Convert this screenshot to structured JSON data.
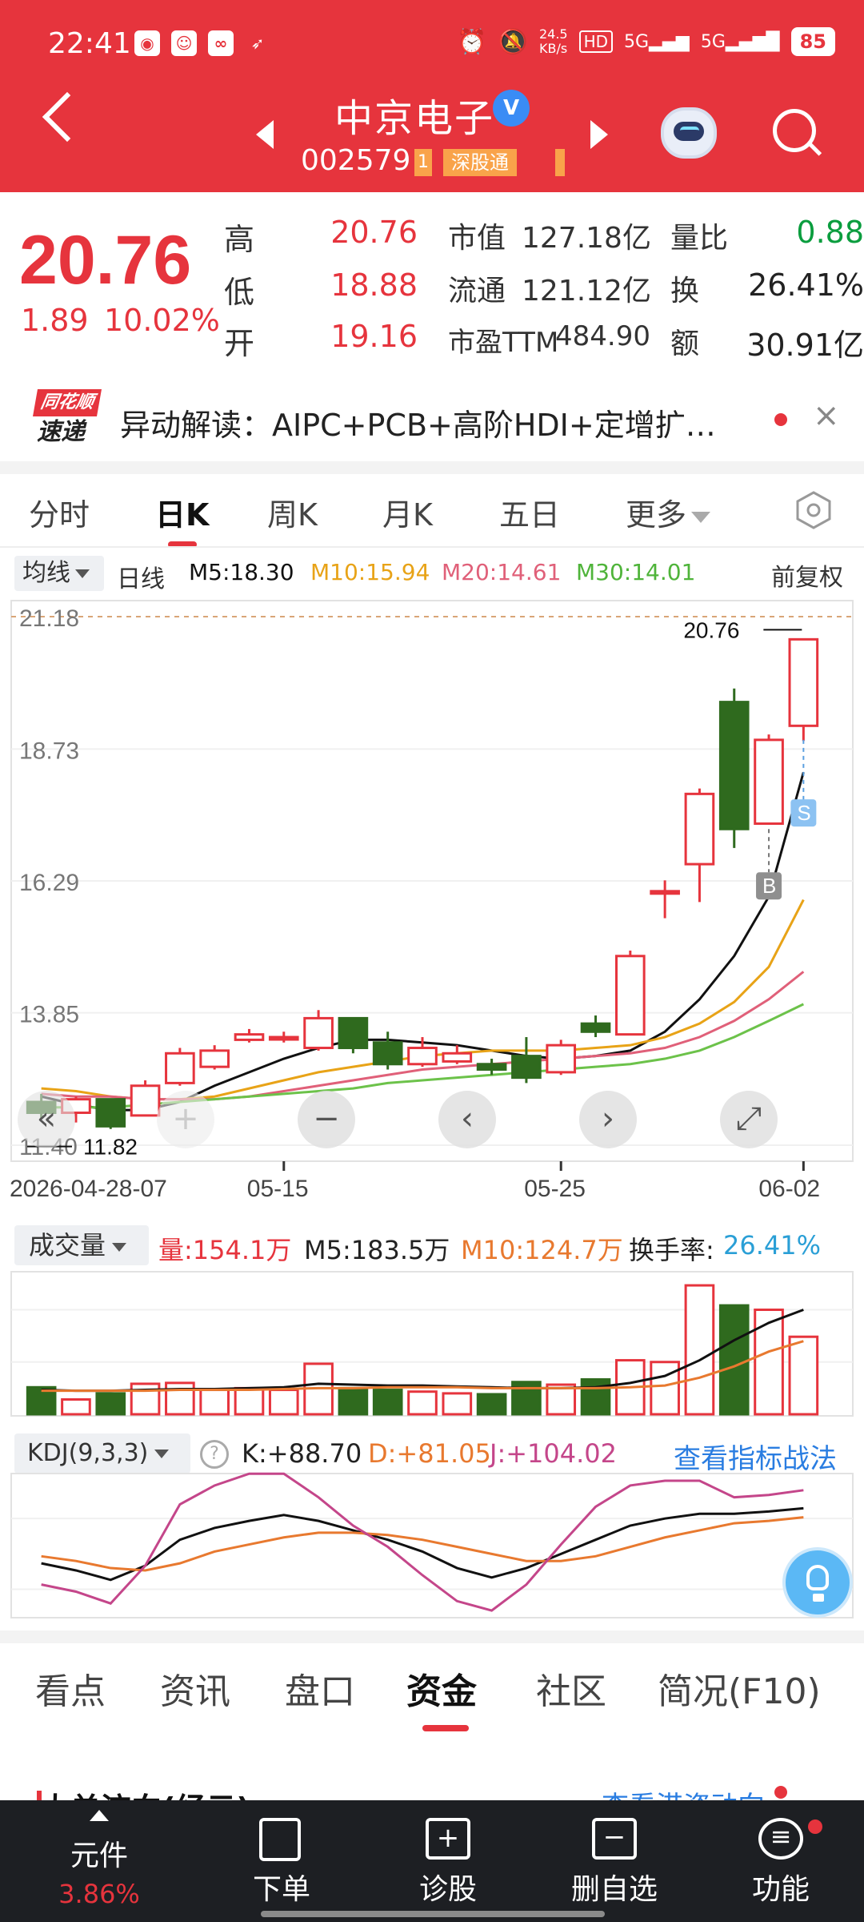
{
  "status_bar": {
    "time": "22:41",
    "net_speed_top": "24.5",
    "net_speed_bottom": "KB/s",
    "hd_label": "HD",
    "sig1": "5G",
    "sig2": "5G",
    "battery": "85"
  },
  "header": {
    "stock_name": "中京电子",
    "verified_glyph": "V",
    "stock_code": "002579",
    "tag_small": "1",
    "tag_connect": "深股通"
  },
  "quote": {
    "price": "20.76",
    "change": "1.89",
    "change_pct": "10.02%",
    "high_label": "高",
    "high": "20.76",
    "low_label": "低",
    "low": "18.88",
    "open_label": "开",
    "open": "19.16",
    "mcap_label": "市值",
    "mcap": "127.18亿",
    "float_label": "流通",
    "float": "121.12亿",
    "pe_label": "市盈TTM",
    "pe": "484.90",
    "vr_label": "量比",
    "vr": "0.88",
    "turnover_label": "换",
    "turnover": "26.41%",
    "amount_label": "额",
    "amount": "30.91亿"
  },
  "news": {
    "logo_top": "同花顺",
    "logo_bottom": "速递",
    "text": "异动解读：AIPC+PCB+高阶HDI+定增扩…",
    "close": "×"
  },
  "tabs": [
    "分时",
    "日K",
    "周K",
    "月K",
    "五日",
    "更多"
  ],
  "ma_row": {
    "selector": "均线",
    "period": "日线",
    "m5": "M5:18.30",
    "m10": "M10:15.94",
    "m20": "M20:14.61",
    "m30": "M30:14.01",
    "adjust": "前复权"
  },
  "kline_chart": {
    "y_labels": [
      "21.18",
      "18.73",
      "16.29",
      "13.85",
      "11.40"
    ],
    "x_labels": [
      "2026-04-28-07",
      "05-15",
      "05-25",
      "06-02"
    ],
    "max_label": "20.76",
    "min_label": "11.82",
    "marker_s": "S",
    "marker_b": "B"
  },
  "chart_controls": [
    "«",
    "+",
    "−",
    "‹",
    "›",
    "⤢"
  ],
  "volume_row": {
    "selector": "成交量",
    "vol": "量:154.1万",
    "m5": "M5:183.5万",
    "m10": "M10:124.7万",
    "turnover_label": "换手率:",
    "turnover_value": "26.41%"
  },
  "kdj_row": {
    "selector": "KDJ(9,3,3)",
    "help": "?",
    "k": "K:+88.70",
    "d": "D:+81.05",
    "j": "J:+104.02",
    "link": "查看指标战法"
  },
  "bottom_tabs": [
    "看点",
    "资讯",
    "盘口",
    "资金",
    "社区",
    "简况(F10)"
  ],
  "peek": {
    "title": "大单流向(经云)",
    "link": "查看港资动向"
  },
  "bottom_nav": {
    "items": [
      "元件",
      "下单",
      "诊股",
      "删自选",
      "功能"
    ],
    "sub": "3.86%"
  },
  "colors": {
    "up": "#e6343d",
    "down": "#2f6a1e",
    "ma5": "#111111",
    "ma10": "#e8a317",
    "ma20": "#e06079",
    "ma30": "#6cc24a",
    "accent_blue": "#2a7de1"
  },
  "chart_data": [
    {
      "type": "candlestick",
      "title": "",
      "ylim": [
        11.4,
        21.18
      ],
      "y_ticks": [
        21.18,
        18.73,
        16.29,
        13.85,
        11.4
      ],
      "x_ticks": [
        "2026-04-28-07",
        "05-15",
        "05-25",
        "06-02"
      ],
      "candles": [
        {
          "o": 12.2,
          "h": 12.35,
          "l": 11.9,
          "c": 12.0
        },
        {
          "o": 12.0,
          "h": 12.3,
          "l": 11.82,
          "c": 12.25
        },
        {
          "o": 12.25,
          "h": 12.15,
          "l": 11.7,
          "c": 11.75
        },
        {
          "o": 11.95,
          "h": 12.6,
          "l": 11.95,
          "c": 12.5
        },
        {
          "o": 12.55,
          "h": 13.2,
          "l": 12.5,
          "c": 13.1
        },
        {
          "o": 12.85,
          "h": 13.25,
          "l": 12.8,
          "c": 13.15
        },
        {
          "o": 13.35,
          "h": 13.55,
          "l": 13.3,
          "c": 13.45
        },
        {
          "o": 13.4,
          "h": 13.5,
          "l": 13.3,
          "c": 13.4
        },
        {
          "o": 13.2,
          "h": 13.9,
          "l": 13.15,
          "c": 13.75
        },
        {
          "o": 13.75,
          "h": 13.75,
          "l": 13.1,
          "c": 13.2
        },
        {
          "o": 13.3,
          "h": 13.5,
          "l": 12.8,
          "c": 12.9
        },
        {
          "o": 12.9,
          "h": 13.4,
          "l": 12.85,
          "c": 13.2
        },
        {
          "o": 12.95,
          "h": 13.25,
          "l": 12.9,
          "c": 13.1
        },
        {
          "o": 12.9,
          "h": 13.0,
          "l": 12.7,
          "c": 12.8
        },
        {
          "o": 13.05,
          "h": 13.4,
          "l": 12.55,
          "c": 12.65
        },
        {
          "o": 12.75,
          "h": 13.35,
          "l": 12.7,
          "c": 13.25
        },
        {
          "o": 13.65,
          "h": 13.8,
          "l": 13.4,
          "c": 13.5
        },
        {
          "o": 13.45,
          "h": 15.0,
          "l": 13.45,
          "c": 14.9
        },
        {
          "o": 16.1,
          "h": 16.3,
          "l": 15.6,
          "c": 16.1
        },
        {
          "o": 16.6,
          "h": 18.0,
          "l": 15.9,
          "c": 17.9
        },
        {
          "o": 19.6,
          "h": 19.85,
          "l": 16.9,
          "c": 17.25
        },
        {
          "o": 17.35,
          "h": 19.0,
          "l": 17.35,
          "c": 18.9
        },
        {
          "o": 19.16,
          "h": 20.76,
          "l": 18.88,
          "c": 20.76
        }
      ],
      "series": [
        {
          "name": "M5",
          "values": [
            12.3,
            12.15,
            12.05,
            12.05,
            12.2,
            12.5,
            12.75,
            13.0,
            13.2,
            13.35,
            13.35,
            13.3,
            13.25,
            13.15,
            13.05,
            13.0,
            13.05,
            13.15,
            13.5,
            14.1,
            14.9,
            16.0,
            18.3
          ]
        },
        {
          "name": "M10",
          "values": [
            12.45,
            12.4,
            12.3,
            12.25,
            12.25,
            12.3,
            12.45,
            12.6,
            12.75,
            12.85,
            12.95,
            13.05,
            13.1,
            13.15,
            13.15,
            13.15,
            13.2,
            13.25,
            13.4,
            13.65,
            14.05,
            14.7,
            15.94
          ]
        },
        {
          "name": "M20",
          "values": [
            12.35,
            12.3,
            12.3,
            12.25,
            12.25,
            12.25,
            12.3,
            12.4,
            12.5,
            12.6,
            12.7,
            12.8,
            12.85,
            12.9,
            12.95,
            13.0,
            13.05,
            13.1,
            13.2,
            13.4,
            13.7,
            14.1,
            14.61
          ]
        },
        {
          "name": "M30",
          "values": [
            12.1,
            12.1,
            12.1,
            12.15,
            12.2,
            12.25,
            12.3,
            12.35,
            12.4,
            12.45,
            12.55,
            12.6,
            12.65,
            12.7,
            12.75,
            12.8,
            12.85,
            12.9,
            13.0,
            13.15,
            13.4,
            13.7,
            14.01
          ]
        }
      ],
      "annotations": {
        "max": 20.76,
        "min": 11.82
      }
    },
    {
      "type": "bar",
      "title": "",
      "unit": "万",
      "values": [
        31,
        17,
        24,
        35,
        36,
        28,
        30,
        28,
        58,
        30,
        28,
        26,
        24,
        23,
        37,
        34,
        40,
        62,
        60,
        148,
        125,
        120,
        89
      ],
      "up": [
        false,
        true,
        false,
        true,
        true,
        true,
        true,
        true,
        true,
        false,
        false,
        true,
        true,
        false,
        false,
        true,
        false,
        true,
        true,
        true,
        false,
        true,
        true
      ],
      "series": [
        {
          "name": "M5",
          "values": [
            28,
            27,
            27,
            28,
            29,
            29,
            30,
            31,
            35,
            34,
            33,
            33,
            32,
            31,
            30,
            30,
            31,
            36,
            44,
            62,
            85,
            105,
            120
          ]
        },
        {
          "name": "M10",
          "values": [
            27,
            27,
            27,
            27,
            28,
            28,
            28,
            29,
            30,
            30,
            31,
            31,
            31,
            30,
            30,
            30,
            30,
            31,
            33,
            42,
            55,
            72,
            84
          ]
        }
      ]
    },
    {
      "type": "line",
      "title": "",
      "ylim": [
        0,
        110
      ],
      "series": [
        {
          "name": "K",
          "values": [
            42,
            36,
            28,
            40,
            62,
            72,
            78,
            83,
            78,
            70,
            62,
            52,
            38,
            30,
            38,
            50,
            62,
            74,
            80,
            84,
            84,
            86,
            88.7
          ]
        },
        {
          "name": "D",
          "values": [
            48,
            44,
            38,
            36,
            42,
            52,
            58,
            64,
            68,
            68,
            66,
            62,
            56,
            50,
            44,
            44,
            48,
            56,
            64,
            70,
            76,
            78,
            81.05
          ]
        },
        {
          "name": "J",
          "values": [
            24,
            18,
            8,
            40,
            92,
            108,
            118,
            118,
            98,
            74,
            56,
            32,
            10,
            2,
            24,
            58,
            90,
            108,
            112,
            112,
            98,
            100,
            104.02
          ]
        }
      ]
    }
  ]
}
